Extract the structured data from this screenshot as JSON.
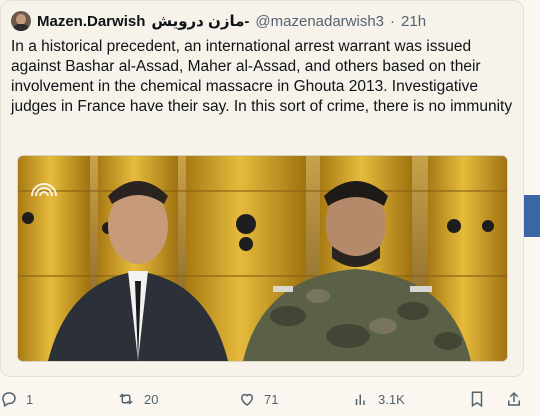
{
  "tweet": {
    "display_name": "Mazen.Darwish",
    "display_name_arabic": "مازن درويش-",
    "handle": "@mazenadarwish3",
    "separator": "·",
    "time": "21h",
    "text": "In a historical precedent, an international arrest warrant was issued against Bashar al-Assad, Maher al-Assad, and others based on their involvement in the chemical massacre in Ghouta 2013. Investigative judges in France have their say. In this sort of crime, there is no immunity"
  },
  "actions": {
    "reply_count": "1",
    "retweet_count": "20",
    "like_count": "71",
    "views_count": "3.1K"
  },
  "icons": [
    "reply-icon",
    "retweet-icon",
    "like-icon",
    "views-icon",
    "bookmark-icon",
    "share-icon"
  ],
  "colors": {
    "accent": "#3b66a5",
    "barrel": "#d7a62b",
    "text_secondary": "#536471"
  }
}
